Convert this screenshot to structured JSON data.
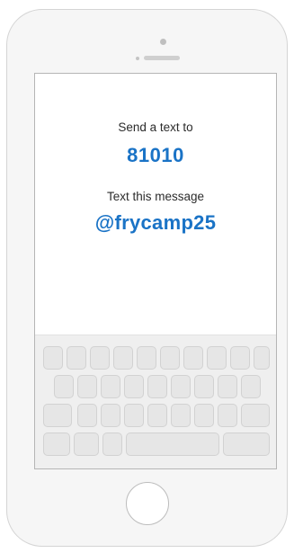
{
  "screen": {
    "line1": "Send a text to",
    "code": "81010",
    "line2": "Text this message",
    "handle": "@frycamp25"
  },
  "colors": {
    "accent": "#1a73c6",
    "text": "#2b2b2b",
    "phone_body": "#f6f6f6",
    "keyboard": "#efefef"
  },
  "keyboard": {
    "rows": [
      10,
      9,
      9,
      5
    ]
  }
}
